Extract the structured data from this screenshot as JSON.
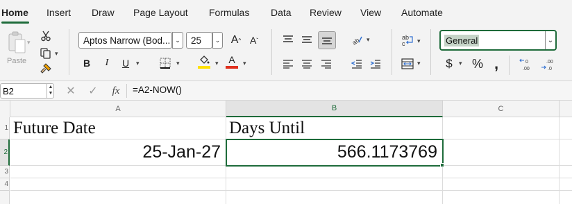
{
  "ribbon_tabs": [
    "Home",
    "Insert",
    "Draw",
    "Page Layout",
    "Formulas",
    "Data",
    "Review",
    "View",
    "Automate"
  ],
  "active_tab": "Home",
  "clipboard": {
    "paste_label": "Paste"
  },
  "font": {
    "name": "Aptos Narrow (Bod...",
    "size": "25"
  },
  "number_format": "General",
  "accent_color": "#1e6b3a",
  "font_color_bar": "#e0301e",
  "fill_color_bar": "#ffe000",
  "formula_bar": {
    "cell_ref": "B2",
    "fx_label": "fx",
    "formula": "=A2-NOW()"
  },
  "columns": [
    "A",
    "B",
    "C"
  ],
  "rows": [
    "1",
    "2",
    "3",
    "4"
  ],
  "cells": {
    "A1": "Future Date",
    "B1": "Days Until",
    "A2": "25-Jan-27",
    "B2": "566.1173769"
  },
  "icons": [
    "cut-icon",
    "copy-icon",
    "format-painter-icon",
    "increase-font-icon",
    "decrease-font-icon",
    "bold-icon",
    "italic-icon",
    "underline-icon",
    "borders-icon",
    "fill-color-icon",
    "font-color-icon",
    "align-top-icon",
    "align-middle-icon",
    "align-bottom-icon",
    "orientation-icon",
    "wrap-text-icon",
    "align-left-icon",
    "align-center-icon",
    "align-right-icon",
    "decrease-indent-icon",
    "increase-indent-icon",
    "merge-icon",
    "currency-icon",
    "percent-icon",
    "comma-icon",
    "increase-decimal-icon",
    "decrease-decimal-icon"
  ]
}
